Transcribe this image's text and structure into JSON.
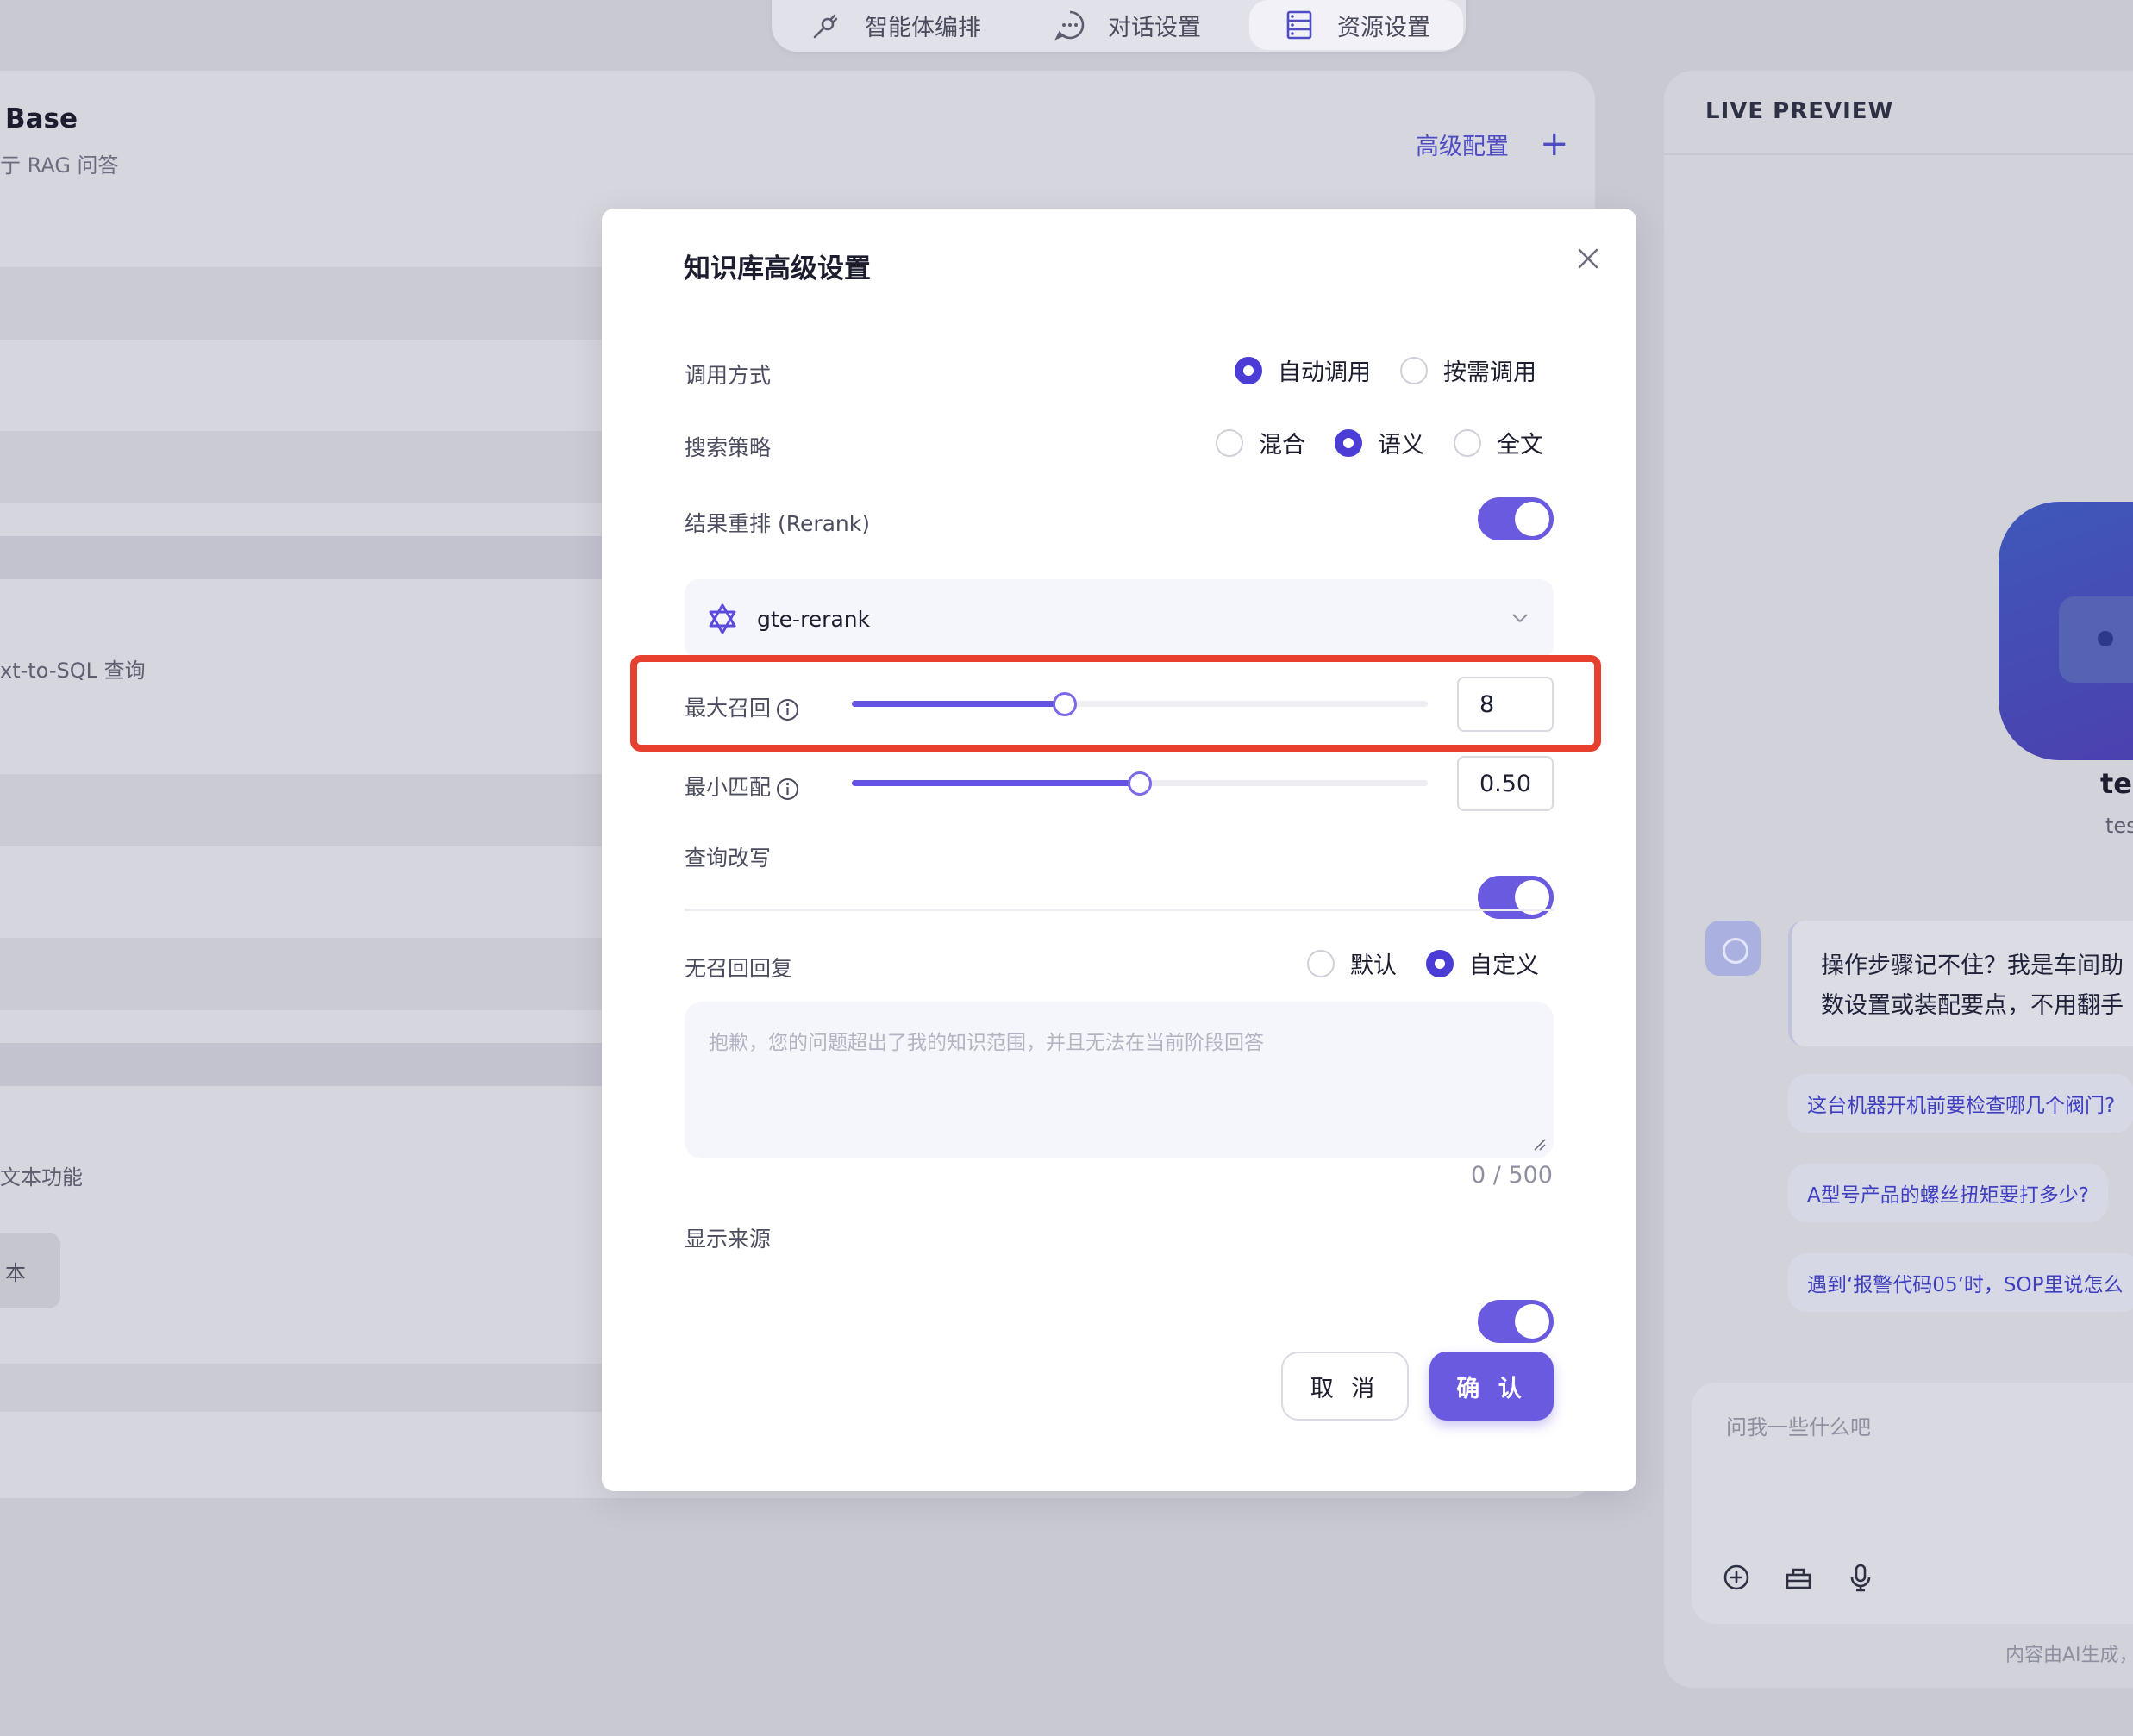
{
  "topnav": {
    "tabs": [
      {
        "label": "智能体编排",
        "icon": "plug-icon"
      },
      {
        "label": "对话设置",
        "icon": "chat-bubble-icon"
      },
      {
        "label": "资源设置",
        "icon": "server-icon",
        "active": true
      }
    ]
  },
  "left_panel": {
    "title": "Base",
    "subtitle": "亍 RAG 问答",
    "advanced_label": "高级配置",
    "advanced_icon": "plus-icon",
    "sql_text": "xt-to-SQL 查询",
    "func_text": "文本功能",
    "button_label": "本"
  },
  "preview": {
    "header": "LIVE PREVIEW",
    "bot_name": "tes",
    "bot_sub": "tes",
    "message": [
      "操作步骤记不住？我是车间助",
      "数设置或装配要点，不用翻手"
    ],
    "suggestions": [
      "这台机器开机前要检查哪几个阀门?",
      "A型号产品的螺丝扭矩要打多少?",
      "遇到‘报警代码05’时，SOP里说怎么"
    ],
    "input_placeholder": "问我一些什么吧",
    "footer": "内容由AI生成，"
  },
  "modal": {
    "title": "知识库高级设置",
    "invoke": {
      "label": "调用方式",
      "options": [
        "自动调用",
        "按需调用"
      ],
      "selected": "自动调用"
    },
    "search": {
      "label": "搜索策略",
      "options": [
        "混合",
        "语义",
        "全文"
      ],
      "selected": "语义"
    },
    "rerank": {
      "label": "结果重排 (Rerank)",
      "enabled": true
    },
    "rerank_model": {
      "value": "gte-rerank",
      "icon": "qwen-logo-icon"
    },
    "max_recall": {
      "label": "最大召回",
      "value": "8",
      "slider_fraction": 0.37
    },
    "min_match": {
      "label": "最小匹配",
      "value": "0.50",
      "slider_fraction": 0.5
    },
    "query_rewrite": {
      "label": "查询改写",
      "enabled": true
    },
    "no_recall": {
      "label": "无召回回复",
      "options": [
        "默认",
        "自定义"
      ],
      "selected": "自定义",
      "placeholder": "抱歉，您的问题超出了我的知识范围，并且无法在当前阶段回答",
      "counter": "0 / 500"
    },
    "show_source": {
      "label": "显示来源",
      "enabled": true
    },
    "cancel_label": "取 消",
    "confirm_label": "确 认"
  },
  "colors": {
    "accent": "#6a5ae0",
    "radio_on": "#4a3cd4",
    "highlight": "#e8402e",
    "link": "#4f4cc4"
  }
}
